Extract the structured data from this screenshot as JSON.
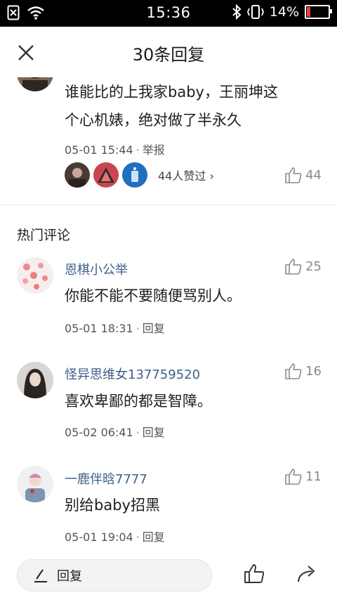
{
  "status_bar": {
    "time": "15:36",
    "battery": "14%"
  },
  "header": {
    "title": "30条回复",
    "close_icon": "close-icon"
  },
  "main_comment": {
    "text_line1": "谁能比的上我家baby，王丽坤这",
    "text_line2": "个心机婊，绝对做了半永久",
    "time": "05-01 15:44",
    "report": "举报",
    "likers_text": "44人赞过 ›",
    "likes": "44"
  },
  "section": {
    "title": "热门评论"
  },
  "comments": [
    {
      "username": "恩棋小公举",
      "text": "你能不能不要随便骂别人。",
      "time": "05-01 18:31",
      "action": "回复",
      "likes": "25"
    },
    {
      "username": "怪异思维女137759520",
      "text": "喜欢卑鄙的都是智障。",
      "time": "05-02 06:41",
      "action": "回复",
      "likes": "16"
    },
    {
      "username": "一鹿伴晗7777",
      "text": "别给baby招黑",
      "time": "05-01 19:04",
      "action": "回复",
      "likes": "11"
    }
  ],
  "bottom_bar": {
    "reply_label": "回复"
  },
  "colors": {
    "username": "#3e5f8a",
    "battery_low": "#e64340"
  }
}
